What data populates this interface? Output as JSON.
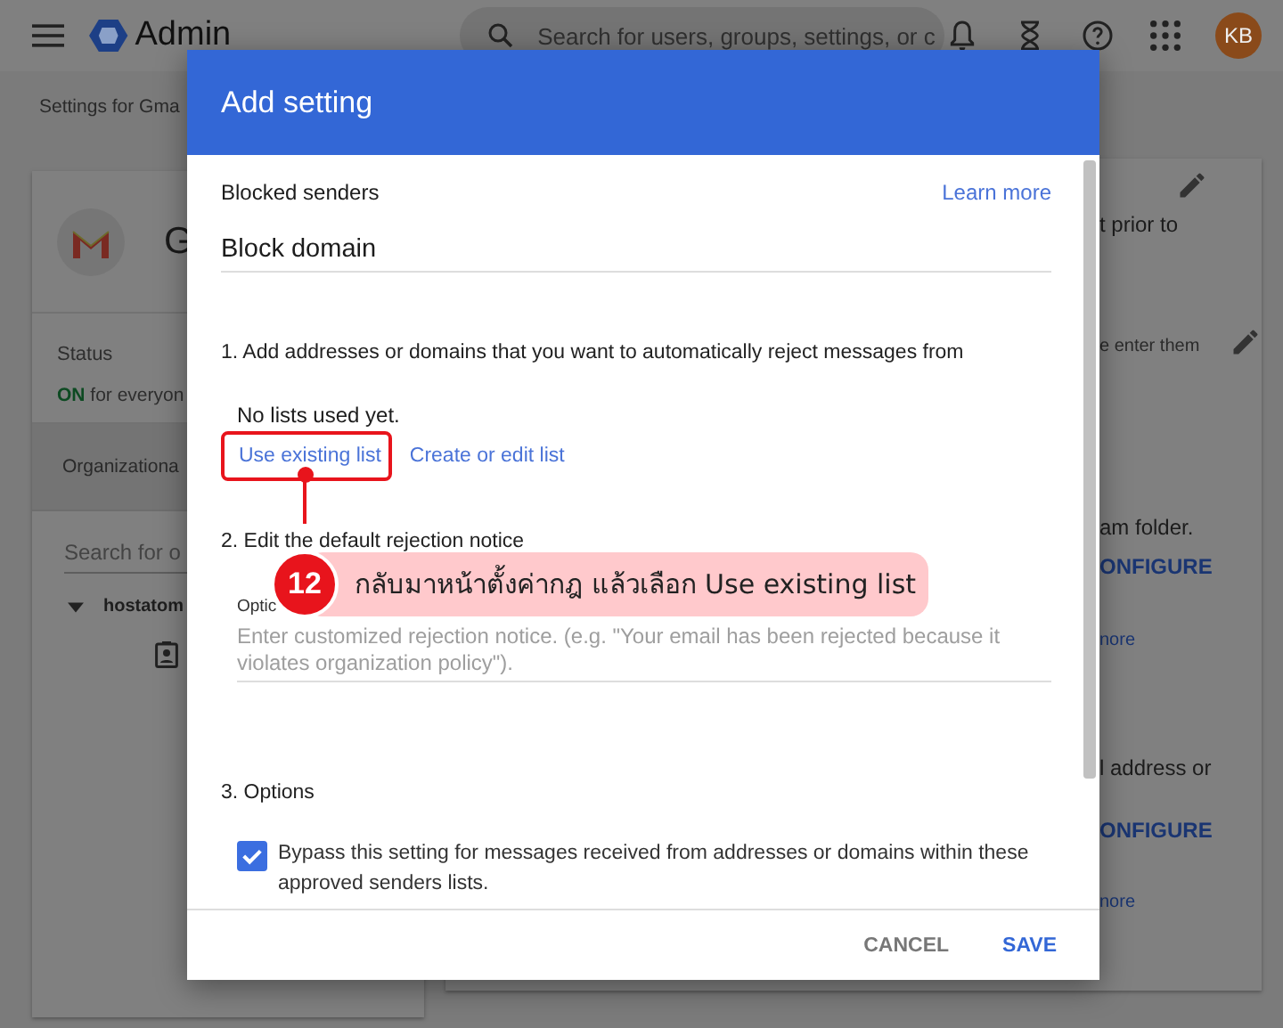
{
  "top_bar": {
    "app_name": "Admin",
    "search": {
      "placeholder": "Search for users, groups, settings, or c"
    },
    "avatar": "KB"
  },
  "breadcrumb": "Settings for Gma",
  "left_panel": {
    "app_letter": "G",
    "status": {
      "label": "Status",
      "value": "ON",
      "scope": "for everyon"
    },
    "org_units_label": "Organizationa",
    "search": {
      "placeholder": "Search for o"
    },
    "tree": [
      {
        "label": "hostatom",
        "expanded": true
      }
    ]
  },
  "right_panel": {
    "items": [
      {
        "kind": "edit"
      },
      {
        "kind": "text",
        "text": "t prior to"
      },
      {
        "kind": "hint",
        "text": "e enter them"
      },
      {
        "kind": "text",
        "text": "am folder."
      },
      {
        "kind": "action",
        "text": "ONFIGURE"
      },
      {
        "kind": "link",
        "text": "nore"
      },
      {
        "kind": "text",
        "text": "l address or"
      },
      {
        "kind": "action",
        "text": "ONFIGURE"
      },
      {
        "kind": "link",
        "text": "nore"
      }
    ]
  },
  "dialog": {
    "title": "Add setting",
    "section": "Blocked senders",
    "learn_more": "Learn more",
    "name_value": "Block domain",
    "step1": {
      "heading": "1. Add addresses or domains that you want to automatically reject messages from",
      "empty_note": "No lists used yet.",
      "links": [
        {
          "label": "Use existing list",
          "highlighted": true
        },
        {
          "label": "Create or edit list",
          "highlighted": false
        }
      ]
    },
    "step2": {
      "heading": "2. Edit the default rejection notice",
      "field": {
        "label": "Optic",
        "placeholder": "Enter customized rejection notice. (e.g. \"Your email has been rejected because it violates organization policy\")."
      }
    },
    "step3": {
      "heading": "3. Options",
      "options": [
        {
          "label": "Bypass this setting for messages received from addresses or domains within these approved senders lists.",
          "checked": true
        }
      ]
    },
    "buttons": [
      {
        "label": "CANCEL",
        "primary": false
      },
      {
        "label": "SAVE",
        "primary": true
      }
    ]
  },
  "callout": {
    "step": "12",
    "text": "กลับมาหน้าตั้งค่ากฎ แล้วเลือก Use existing list"
  }
}
